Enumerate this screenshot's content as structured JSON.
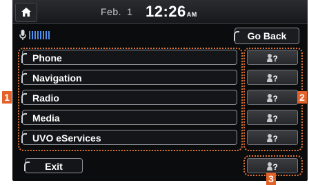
{
  "status_bar": {
    "date_month": "Feb.",
    "date_day": "1",
    "time": "12:26",
    "ampm": "AM"
  },
  "voice": {
    "go_back_label": "Go Back"
  },
  "menu": {
    "items": [
      {
        "label": "Phone"
      },
      {
        "label": "Navigation"
      },
      {
        "label": "Radio"
      },
      {
        "label": "Media"
      },
      {
        "label": "UVO eServices"
      }
    ]
  },
  "footer": {
    "exit_label": "Exit"
  },
  "callouts": {
    "one": "1",
    "two": "2",
    "three": "3"
  },
  "colors": {
    "accent": "#e2632a",
    "voice_level": "#4f8ff0",
    "background": "#0b0c0e"
  },
  "icons": {
    "home": "home-icon",
    "microphone": "microphone-icon",
    "voice_help": "voice-help-icon"
  }
}
